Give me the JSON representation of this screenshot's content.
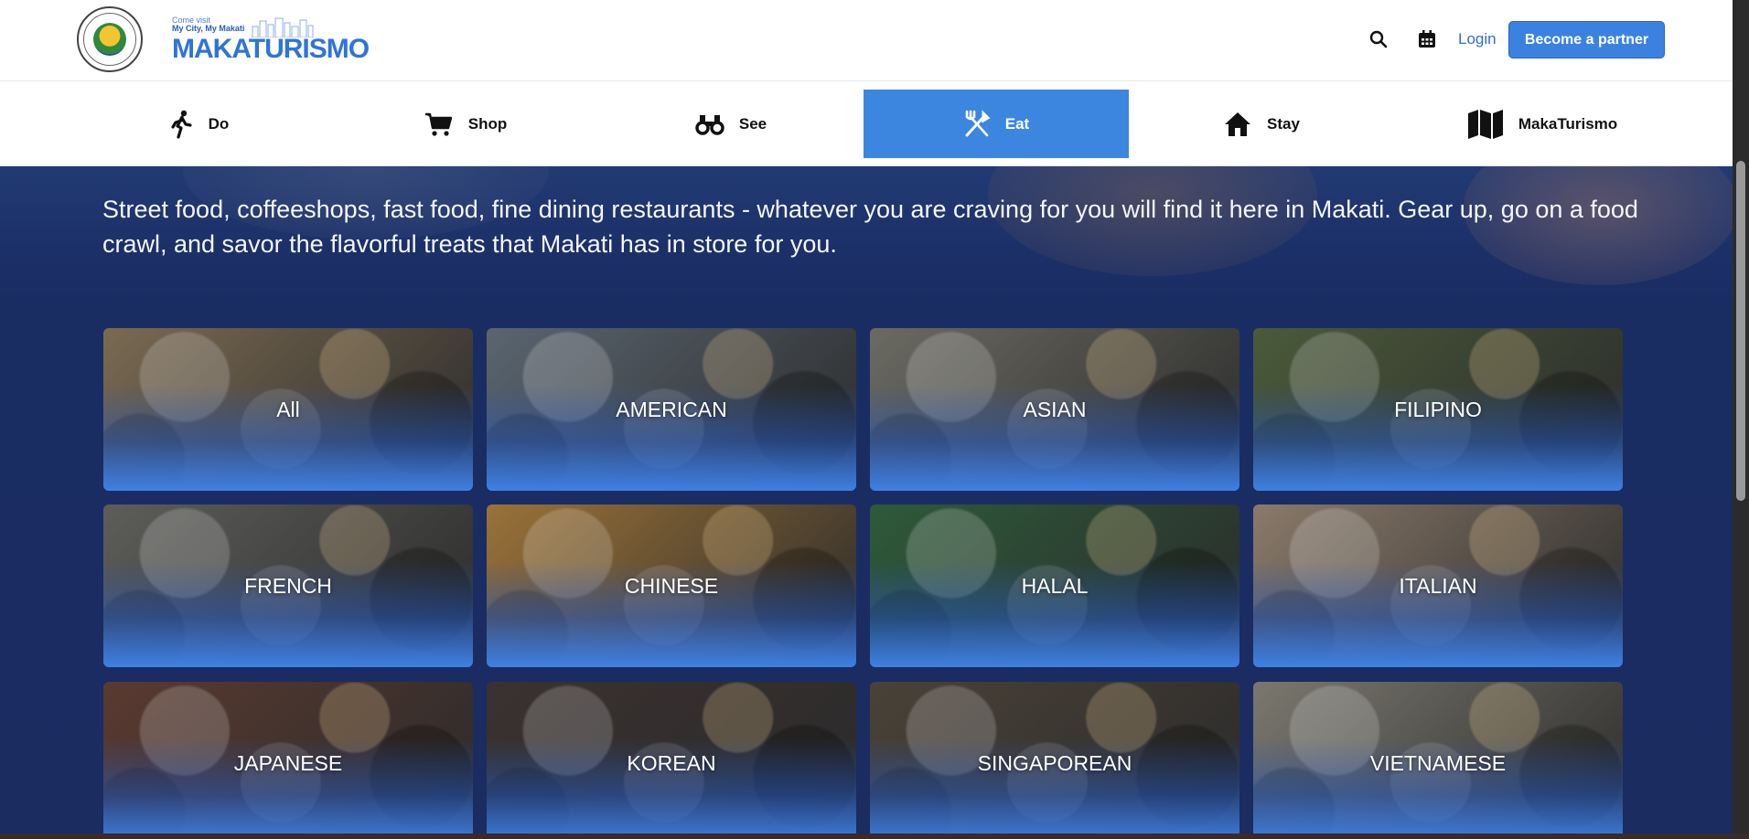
{
  "header": {
    "seal_text": "LUNGSOD NG MAKATI · PILIPINAS",
    "logo": {
      "tag_line_1": "Come visit",
      "tag_line_2": "My City, My Makati",
      "wordmark": "MAKATURISMO"
    },
    "login_label": "Login",
    "partner_label": "Become a partner",
    "icons": [
      "search-icon",
      "calendar-icon"
    ]
  },
  "nav": {
    "items": [
      {
        "label": "Do",
        "icon": "walking-person-icon"
      },
      {
        "label": "Shop",
        "icon": "shopping-cart-icon"
      },
      {
        "label": "See",
        "icon": "binoculars-icon"
      },
      {
        "label": "Eat",
        "icon": "fork-knife-icon",
        "active": true
      },
      {
        "label": "Stay",
        "icon": "house-icon"
      },
      {
        "label": "MakaTurismo",
        "icon": "map-icon"
      }
    ],
    "active_color": "#3c86e0"
  },
  "hero": {
    "intro": "Street food, coffeeshops, fast food, fine dining restaurants - whatever you are craving for you will find it here in Makati. Gear up, go on a food crawl, and savor the flavorful treats that Makati has in store for you."
  },
  "categories": [
    {
      "label": "All",
      "tint": "#7a6a52"
    },
    {
      "label": "AMERICAN",
      "tint": "#5a6570"
    },
    {
      "label": "ASIAN",
      "tint": "#6b6a62"
    },
    {
      "label": "FILIPINO",
      "tint": "#4a5a3a"
    },
    {
      "label": "FRENCH",
      "tint": "#5d5d5a"
    },
    {
      "label": "CHINESE",
      "tint": "#9a7238"
    },
    {
      "label": "HALAL",
      "tint": "#2e5a3a"
    },
    {
      "label": "ITALIAN",
      "tint": "#8a7a6a"
    },
    {
      "label": "JAPANESE",
      "tint": "#5a3a30"
    },
    {
      "label": "KOREAN",
      "tint": "#3a3230"
    },
    {
      "label": "SINGAPOREAN",
      "tint": "#4a4238"
    },
    {
      "label": "VIETNAMESE",
      "tint": "#7a786e"
    }
  ],
  "colors": {
    "page_bg": "#1a2d63",
    "card_bottom": "#3f80e2",
    "brand_blue": "#3b82e0"
  }
}
